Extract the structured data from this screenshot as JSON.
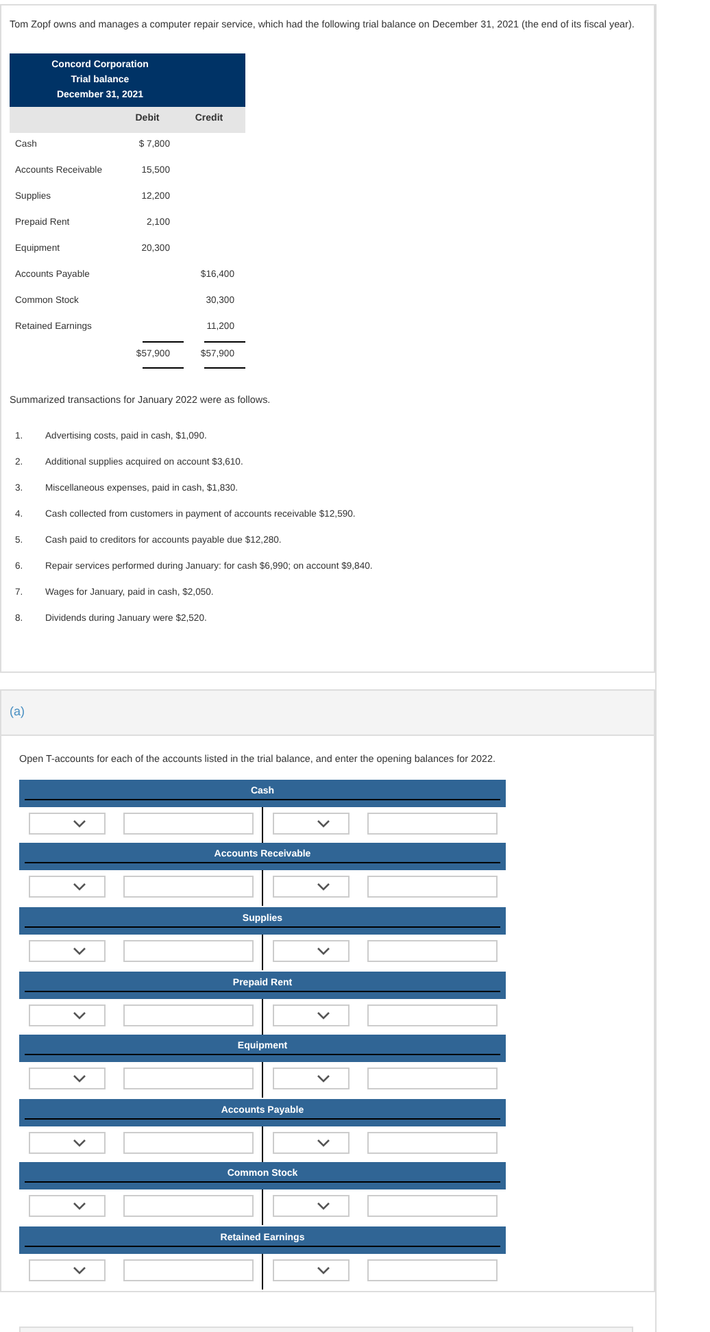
{
  "intro": "Tom Zopf owns and manages a computer repair service, which had the following trial balance on December 31, 2021 (the end of its fiscal year).",
  "trial_balance": {
    "heading": [
      "Concord Corporation",
      "Trial balance",
      "December 31, 2021"
    ],
    "columns": [
      "Debit",
      "Credit"
    ],
    "rows": [
      {
        "account": "Cash",
        "debit": "$ 7,800",
        "credit": ""
      },
      {
        "account": "Accounts Receivable",
        "debit": "15,500",
        "credit": ""
      },
      {
        "account": "Supplies",
        "debit": "12,200",
        "credit": ""
      },
      {
        "account": "Prepaid Rent",
        "debit": "2,100",
        "credit": ""
      },
      {
        "account": "Equipment",
        "debit": "20,300",
        "credit": ""
      },
      {
        "account": "Accounts Payable",
        "debit": "",
        "credit": "$16,400"
      },
      {
        "account": "Common Stock",
        "debit": "",
        "credit": "30,300"
      },
      {
        "account": "Retained Earnings",
        "debit": "",
        "credit": "11,200"
      }
    ],
    "totals": {
      "debit": "$57,900",
      "credit": "$57,900"
    }
  },
  "transactions_intro": "Summarized transactions for January 2022 were as follows.",
  "transactions": [
    {
      "number": "1.",
      "text": "Advertising costs, paid in cash, $1,090."
    },
    {
      "number": "2.",
      "text": "Additional supplies acquired on account $3,610."
    },
    {
      "number": "3.",
      "text": "Miscellaneous expenses, paid in cash, $1,830."
    },
    {
      "number": "4.",
      "text": "Cash collected from customers in payment of accounts receivable $12,590."
    },
    {
      "number": "5.",
      "text": "Cash paid to creditors for accounts payable due $12,280."
    },
    {
      "number": "6.",
      "text": "Repair services performed during January: for cash $6,990; on account $9,840."
    },
    {
      "number": "7.",
      "text": "Wages for January, paid in cash, $2,050."
    },
    {
      "number": "8.",
      "text": "Dividends during January were $2,520."
    }
  ],
  "part": {
    "label": "(a)",
    "instruction": "Open T-accounts for each of the accounts listed in the trial balance, and enter the opening balances for 2022.",
    "t_accounts": [
      {
        "title": "Cash"
      },
      {
        "title": "Accounts Receivable"
      },
      {
        "title": "Supplies"
      },
      {
        "title": "Prepaid Rent"
      },
      {
        "title": "Equipment"
      },
      {
        "title": "Accounts Payable"
      },
      {
        "title": "Common Stock"
      },
      {
        "title": "Retained Earnings"
      }
    ]
  }
}
